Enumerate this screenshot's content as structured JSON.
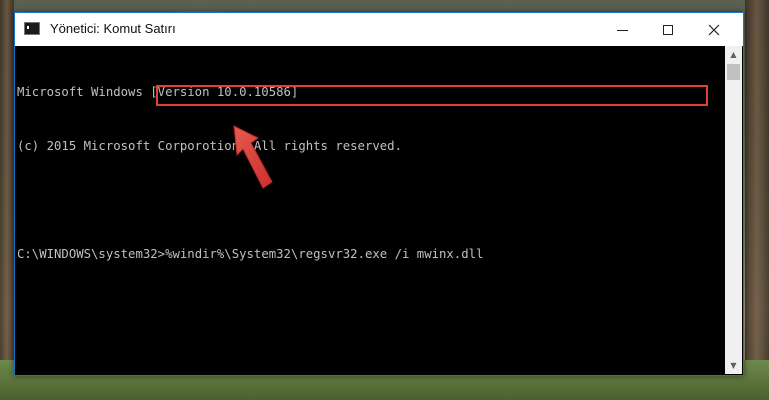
{
  "window": {
    "title": "Yönetici: Komut Satırı"
  },
  "console": {
    "lines": [
      "Microsoft Windows [Version 10.0.10586]",
      "(c) 2015 Microsoft Corporotion. All rights reserved."
    ],
    "prompt": "C:\\WINDOWS\\system32>",
    "command": "%windir%\\System32\\regsvr32.exe /i mwinx.dll"
  },
  "colors": {
    "highlight": "#e0403a",
    "console_bg": "#000000",
    "console_text": "#c0c0c0"
  },
  "icons": {
    "app": "cmd-icon",
    "minimize": "minimize-icon",
    "maximize": "maximize-icon",
    "close": "close-icon",
    "annotation": "red-arrow-icon"
  }
}
